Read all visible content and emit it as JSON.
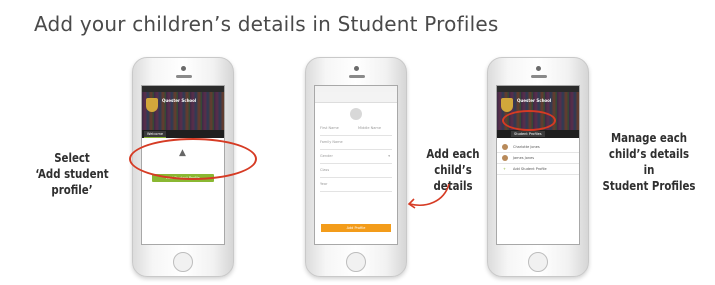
{
  "heading": "Add your children’s details in Student Profiles",
  "callouts": {
    "left": [
      "Select",
      "‘Add student profile’"
    ],
    "middle": [
      "Add each",
      "child’s details"
    ],
    "right": [
      "Manage each",
      "child’s details in",
      "Student Profiles"
    ]
  },
  "phone1": {
    "school_name": "Quester School",
    "welcome_tab": "Welcome",
    "add_button": "Add Student Profile"
  },
  "phone2": {
    "fields": [
      {
        "left": "First Name",
        "right": "Middle Name"
      },
      {
        "left": "Family Name",
        "right": ""
      },
      {
        "left": "Gender",
        "right": ""
      },
      {
        "left": "Class",
        "right": ""
      },
      {
        "left": "Year",
        "right": ""
      }
    ],
    "submit_button": "Add Profile"
  },
  "phone3": {
    "school_name": "Quester School",
    "tab": "Student Profiles",
    "students": [
      "Charlotte Jones",
      "James Jones"
    ],
    "add_row": "Add Student Profile"
  },
  "colors": {
    "accent_green": "#8ab832",
    "accent_orange": "#f39c1a",
    "highlight_red": "#d63b24"
  },
  "icons": [
    "graduation-cap-icon",
    "chevron-down-icon",
    "plus-icon",
    "curved-arrow-icon"
  ]
}
